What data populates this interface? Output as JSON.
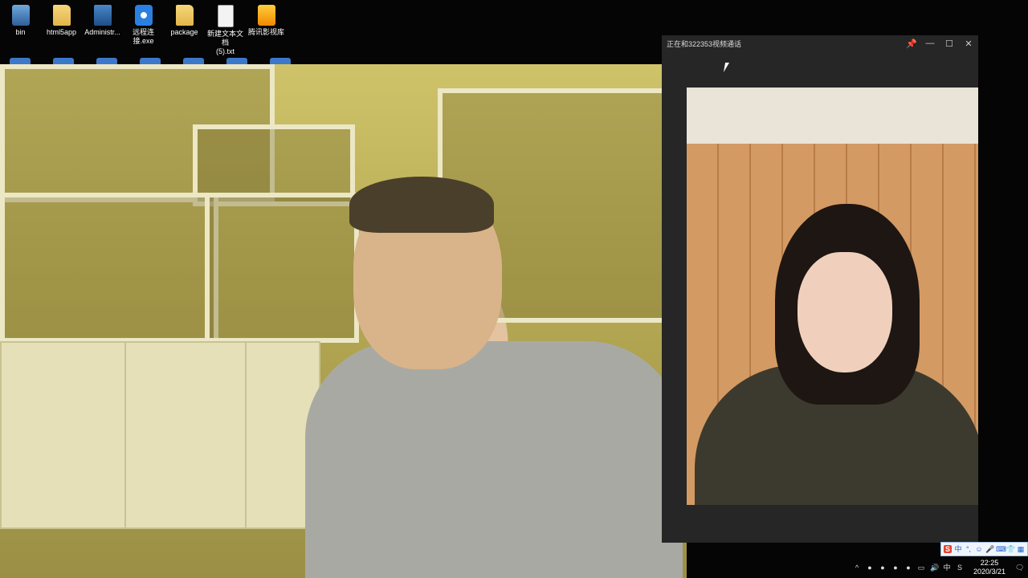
{
  "desktop": {
    "icons": [
      {
        "label": "bin",
        "icon": "recycle-bin-icon"
      },
      {
        "label": "html5app",
        "icon": "folder-icon"
      },
      {
        "label": "Administr...",
        "icon": "user-folder-icon"
      },
      {
        "label": "远程连接.exe",
        "icon": "teamviewer-icon"
      },
      {
        "label": "package",
        "icon": "folder-icon"
      },
      {
        "label": "新建文本文档\n(5).txt",
        "icon": "text-file-icon"
      },
      {
        "label": "腾讯影视库",
        "icon": "video-folder-icon"
      }
    ]
  },
  "call_window": {
    "title": "正在和322353视频通话",
    "pin_icon": "📌",
    "minimize_icon": "—",
    "maximize_icon": "☐",
    "close_icon": "✕"
  },
  "ime": {
    "logo": "S",
    "mode": "中",
    "items": [
      "°,",
      "☺",
      "🎤",
      "⌨",
      "👕",
      "▦"
    ]
  },
  "tray": {
    "chevron": "^",
    "lang": "中",
    "volume_icon": "🔊",
    "time": "22:25",
    "date": "2020/3/21",
    "notification_icon": "🗨"
  }
}
